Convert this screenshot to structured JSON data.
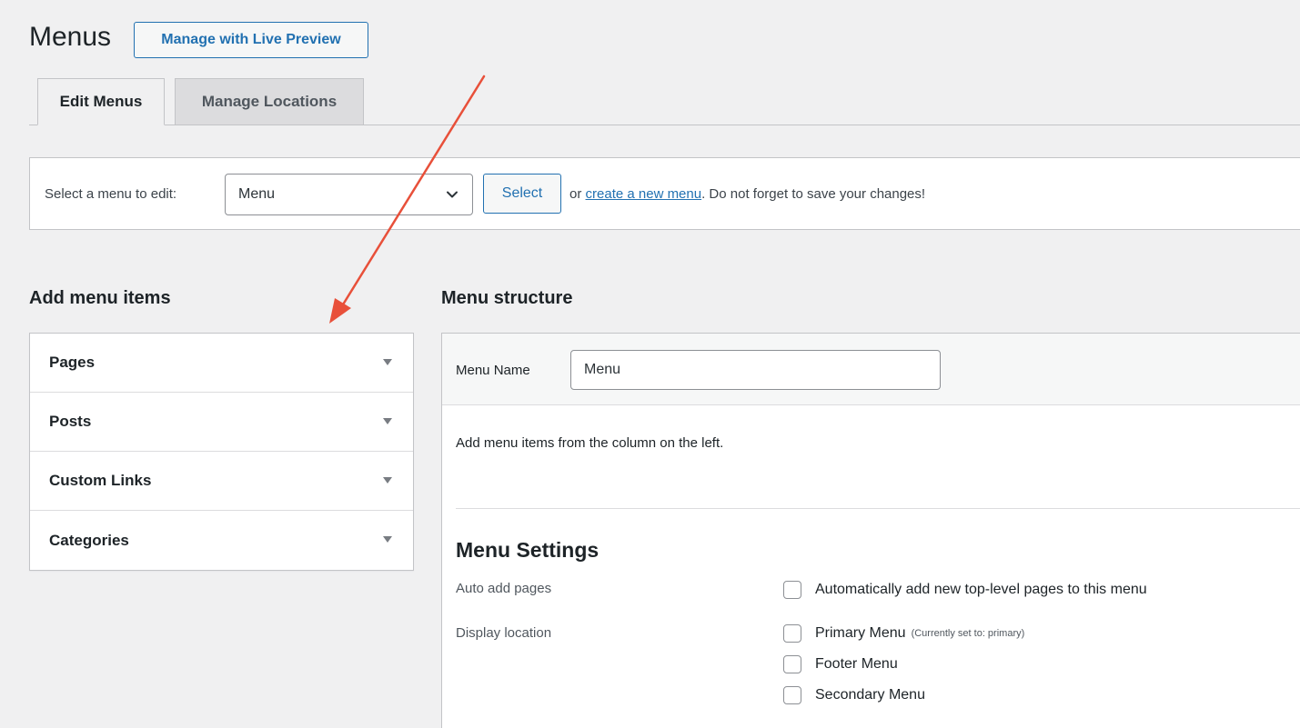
{
  "page": {
    "title": "Menus",
    "live_preview_label": "Manage with Live Preview"
  },
  "tabs": [
    {
      "label": "Edit Menus",
      "active": true
    },
    {
      "label": "Manage Locations",
      "active": false
    }
  ],
  "select_menu": {
    "label": "Select a menu to edit:",
    "selected": "Menu",
    "select_button": "Select",
    "helper_prefix": "or",
    "helper_link": "create a new menu",
    "helper_suffix": ". Do not forget to save your changes!"
  },
  "add_items": {
    "heading": "Add menu items",
    "sections": [
      "Pages",
      "Posts",
      "Custom Links",
      "Categories"
    ]
  },
  "structure": {
    "heading": "Menu structure",
    "menu_name_label": "Menu Name",
    "menu_name_value": "Menu",
    "help_text": "Add menu items from the column on the left."
  },
  "settings": {
    "heading": "Menu Settings",
    "auto_add_label": "Auto add pages",
    "auto_add_option": "Automatically add new top-level pages to this menu",
    "display_location_label": "Display location",
    "locations": [
      {
        "label": "Primary Menu",
        "note": "(Currently set to: primary)",
        "checked": false
      },
      {
        "label": "Footer Menu",
        "note": "",
        "checked": false
      },
      {
        "label": "Secondary Menu",
        "note": "",
        "checked": false
      }
    ]
  },
  "colors": {
    "accent": "#2271b1",
    "annotation_arrow": "#e8503a",
    "background": "#f0f0f1"
  }
}
